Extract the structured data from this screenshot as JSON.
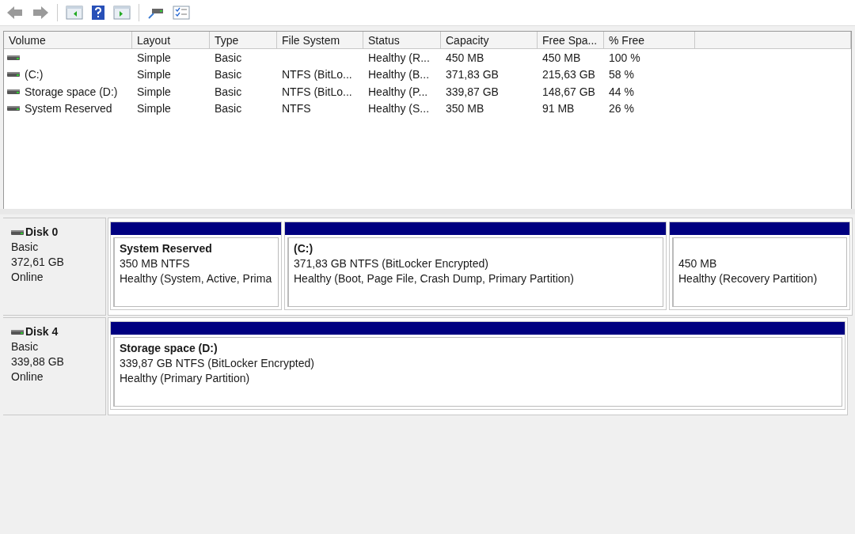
{
  "toolbar": {
    "buttons": [
      {
        "kind": "back",
        "disabled": true
      },
      {
        "kind": "forward",
        "disabled": true
      },
      {
        "kind": "pane"
      },
      {
        "kind": "help"
      },
      {
        "kind": "pane2"
      },
      {
        "kind": "connect"
      },
      {
        "kind": "properties"
      }
    ]
  },
  "table": {
    "columns": [
      "Volume",
      "Layout",
      "Type",
      "File System",
      "Status",
      "Capacity",
      "Free Spa...",
      "% Free"
    ],
    "rows": [
      {
        "cells": [
          "",
          "Simple",
          "Basic",
          "",
          "Healthy (R...",
          "450 MB",
          "450 MB",
          "100 %"
        ]
      },
      {
        "cells": [
          " (C:)",
          "Simple",
          "Basic",
          "NTFS (BitLo...",
          "Healthy (B...",
          "371,83 GB",
          "215,63 GB",
          "58 %"
        ]
      },
      {
        "cells": [
          "Storage space (D:)",
          "Simple",
          "Basic",
          "NTFS (BitLo...",
          "Healthy (P...",
          "339,87 GB",
          "148,67 GB",
          "44 %"
        ]
      },
      {
        "cells": [
          "System Reserved",
          "Simple",
          "Basic",
          "NTFS",
          "Healthy (S...",
          "350 MB",
          "91 MB",
          "26 %"
        ]
      }
    ]
  },
  "disks": [
    {
      "name": "Disk 0",
      "type": "Basic",
      "size": "372,61 GB",
      "status": "Online",
      "partitions": [
        {
          "name": "System Reserved",
          "size": "350 MB NTFS",
          "status": "Healthy (System, Active, Prima"
        },
        {
          "name": " (C:)",
          "size": "371,83 GB NTFS (BitLocker Encrypted)",
          "status": "Healthy (Boot, Page File, Crash Dump, Primary Partition)"
        },
        {
          "size": "450 MB",
          "status": "Healthy (Recovery Partition)"
        }
      ]
    },
    {
      "name": "Disk 4",
      "type": "Basic",
      "size": "339,88 GB",
      "status": "Online",
      "partitions": [
        {
          "name": "Storage space  (D:)",
          "size": "339,87 GB NTFS (BitLocker Encrypted)",
          "status": "Healthy (Primary Partition)"
        }
      ]
    }
  ]
}
